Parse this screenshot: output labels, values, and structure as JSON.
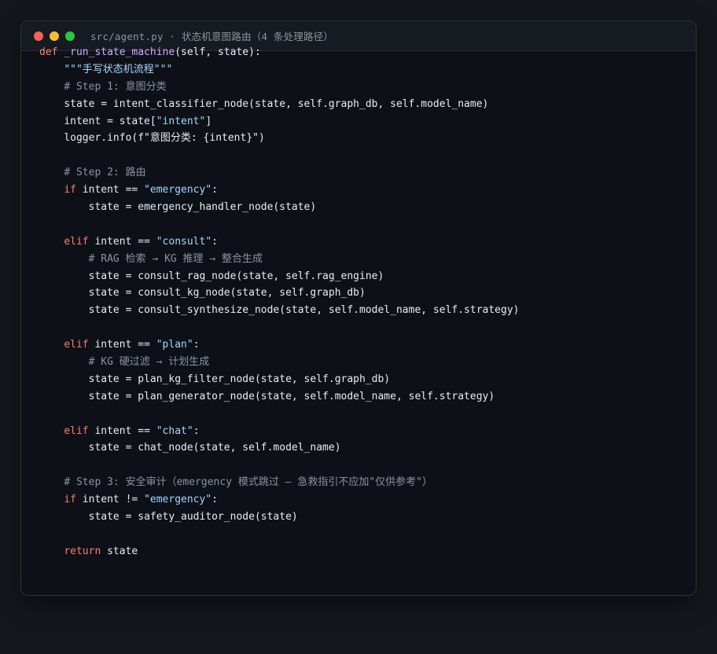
{
  "window": {
    "title": "src/agent.py · 状态机意图路由（4 条处理路径）",
    "buttons": [
      "close",
      "minimize",
      "maximize"
    ]
  },
  "code": {
    "language": "python",
    "lines": [
      {
        "indent": 0,
        "tokens": [
          {
            "t": "kw",
            "v": "def"
          },
          {
            "t": "pl",
            "v": " "
          },
          {
            "t": "fn",
            "v": "_run_state_machine"
          },
          {
            "t": "pl",
            "v": "(self, state):"
          }
        ]
      },
      {
        "indent": 1,
        "tokens": [
          {
            "t": "doc",
            "v": "\"\"\"手写状态机流程\"\"\""
          }
        ]
      },
      {
        "indent": 1,
        "tokens": [
          {
            "t": "cm",
            "v": "# Step 1: 意图分类"
          }
        ]
      },
      {
        "indent": 1,
        "tokens": [
          {
            "t": "pl",
            "v": "state = intent_classifier_node(state, self.graph_db, self.model_name)"
          }
        ]
      },
      {
        "indent": 1,
        "tokens": [
          {
            "t": "pl",
            "v": "intent = state["
          },
          {
            "t": "str",
            "v": "\"intent\""
          },
          {
            "t": "pl",
            "v": "]"
          }
        ]
      },
      {
        "indent": 1,
        "tokens": [
          {
            "t": "pl",
            "v": "logger.info(f\"意图分类: {intent}\")"
          }
        ]
      },
      {
        "indent": 0,
        "tokens": []
      },
      {
        "indent": 1,
        "tokens": [
          {
            "t": "cm",
            "v": "# Step 2: 路由"
          }
        ]
      },
      {
        "indent": 1,
        "tokens": [
          {
            "t": "kw",
            "v": "if"
          },
          {
            "t": "pl",
            "v": " intent == "
          },
          {
            "t": "str",
            "v": "\"emergency\""
          },
          {
            "t": "pl",
            "v": ":"
          }
        ]
      },
      {
        "indent": 2,
        "tokens": [
          {
            "t": "pl",
            "v": "state = emergency_handler_node(state)"
          }
        ]
      },
      {
        "indent": 0,
        "tokens": []
      },
      {
        "indent": 1,
        "tokens": [
          {
            "t": "kw",
            "v": "elif"
          },
          {
            "t": "pl",
            "v": " intent == "
          },
          {
            "t": "str",
            "v": "\"consult\""
          },
          {
            "t": "pl",
            "v": ":"
          }
        ]
      },
      {
        "indent": 2,
        "tokens": [
          {
            "t": "cm",
            "v": "# RAG 检索 → KG 推理 → 整合生成"
          }
        ]
      },
      {
        "indent": 2,
        "tokens": [
          {
            "t": "pl",
            "v": "state = consult_rag_node(state, self.rag_engine)"
          }
        ]
      },
      {
        "indent": 2,
        "tokens": [
          {
            "t": "pl",
            "v": "state = consult_kg_node(state, self.graph_db)"
          }
        ]
      },
      {
        "indent": 2,
        "tokens": [
          {
            "t": "pl",
            "v": "state = consult_synthesize_node(state, self.model_name, self.strategy)"
          }
        ]
      },
      {
        "indent": 0,
        "tokens": []
      },
      {
        "indent": 1,
        "tokens": [
          {
            "t": "kw",
            "v": "elif"
          },
          {
            "t": "pl",
            "v": " intent == "
          },
          {
            "t": "str",
            "v": "\"plan\""
          },
          {
            "t": "pl",
            "v": ":"
          }
        ]
      },
      {
        "indent": 2,
        "tokens": [
          {
            "t": "cm",
            "v": "# KG 硬过滤 → 计划生成"
          }
        ]
      },
      {
        "indent": 2,
        "tokens": [
          {
            "t": "pl",
            "v": "state = plan_kg_filter_node(state, self.graph_db)"
          }
        ]
      },
      {
        "indent": 2,
        "tokens": [
          {
            "t": "pl",
            "v": "state = plan_generator_node(state, self.model_name, self.strategy)"
          }
        ]
      },
      {
        "indent": 0,
        "tokens": []
      },
      {
        "indent": 1,
        "tokens": [
          {
            "t": "kw",
            "v": "elif"
          },
          {
            "t": "pl",
            "v": " intent == "
          },
          {
            "t": "str",
            "v": "\"chat\""
          },
          {
            "t": "pl",
            "v": ":"
          }
        ]
      },
      {
        "indent": 2,
        "tokens": [
          {
            "t": "pl",
            "v": "state = chat_node(state, self.model_name)"
          }
        ]
      },
      {
        "indent": 0,
        "tokens": []
      },
      {
        "indent": 1,
        "tokens": [
          {
            "t": "cm",
            "v": "# Step 3: 安全审计（emergency 模式跳过 — 急救指引不应加\"仅供参考\"）"
          }
        ]
      },
      {
        "indent": 1,
        "tokens": [
          {
            "t": "kw",
            "v": "if"
          },
          {
            "t": "pl",
            "v": " intent != "
          },
          {
            "t": "str",
            "v": "\"emergency\""
          },
          {
            "t": "pl",
            "v": ":"
          }
        ]
      },
      {
        "indent": 2,
        "tokens": [
          {
            "t": "pl",
            "v": "state = safety_auditor_node(state)"
          }
        ]
      },
      {
        "indent": 0,
        "tokens": []
      },
      {
        "indent": 1,
        "tokens": [
          {
            "t": "kw",
            "v": "return"
          },
          {
            "t": "pl",
            "v": " state"
          }
        ]
      }
    ]
  },
  "colors": {
    "background": "#0d1117",
    "keyword": "#ff7b72",
    "function": "#d2a8ff",
    "string": "#a5d6ff",
    "comment": "#8b949e",
    "plain": "#e6edf3"
  }
}
